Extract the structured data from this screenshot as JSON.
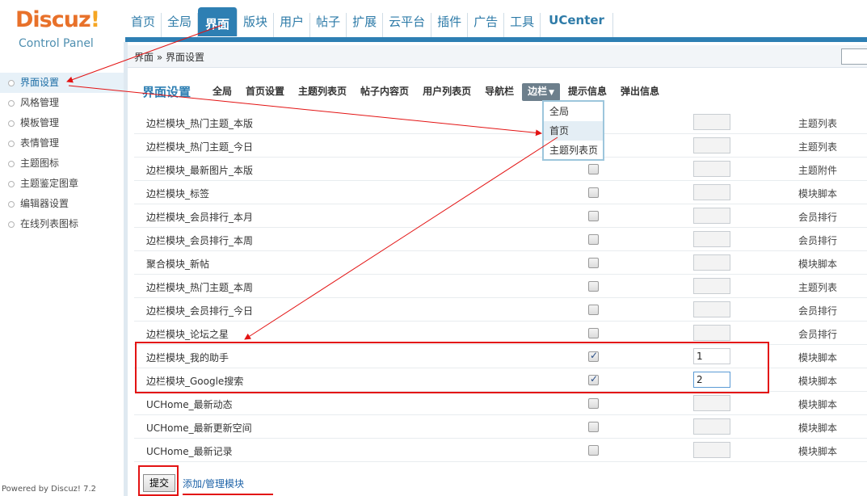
{
  "logo": {
    "brand": "Discuz",
    "bang": "!",
    "subtitle": "Control Panel"
  },
  "topnav": [
    {
      "label": "首页"
    },
    {
      "label": "全局"
    },
    {
      "label": "界面"
    },
    {
      "label": "版块"
    },
    {
      "label": "用户"
    },
    {
      "label": "帖子"
    },
    {
      "label": "扩展"
    },
    {
      "label": "云平台"
    },
    {
      "label": "插件"
    },
    {
      "label": "广告"
    },
    {
      "label": "工具"
    },
    {
      "label": "UCenter"
    }
  ],
  "breadcrumb": "界面 » 界面设置",
  "sidebar": {
    "items": [
      {
        "label": "界面设置"
      },
      {
        "label": "风格管理"
      },
      {
        "label": "模板管理"
      },
      {
        "label": "表情管理"
      },
      {
        "label": "主题图标"
      },
      {
        "label": "主题鉴定图章"
      },
      {
        "label": "编辑器设置"
      },
      {
        "label": "在线列表图标"
      }
    ],
    "powered": "Powered by Discuz! 7.2"
  },
  "page_title": "界面设置",
  "subnav": [
    {
      "label": "全局"
    },
    {
      "label": "首页设置"
    },
    {
      "label": "主题列表页"
    },
    {
      "label": "帖子内容页"
    },
    {
      "label": "用户列表页"
    },
    {
      "label": "导航栏"
    },
    {
      "label": "边栏",
      "caret": "▼"
    },
    {
      "label": "提示信息"
    },
    {
      "label": "弹出信息"
    }
  ],
  "dropdown": [
    {
      "label": "全局"
    },
    {
      "label": "首页"
    },
    {
      "label": "主题列表页"
    }
  ],
  "rows": [
    {
      "name": "边栏模块_热门主题_本版",
      "checked": false,
      "order": "",
      "type": "主题列表"
    },
    {
      "name": "边栏模块_热门主题_今日",
      "checked": false,
      "order": "",
      "type": "主题列表"
    },
    {
      "name": "边栏模块_最新图片_本版",
      "checked": false,
      "order": "",
      "type": "主题附件"
    },
    {
      "name": "边栏模块_标签",
      "checked": false,
      "order": "",
      "type": "模块脚本"
    },
    {
      "name": "边栏模块_会员排行_本月",
      "checked": false,
      "order": "",
      "type": "会员排行"
    },
    {
      "name": "边栏模块_会员排行_本周",
      "checked": false,
      "order": "",
      "type": "会员排行"
    },
    {
      "name": "聚合模块_新帖",
      "checked": false,
      "order": "",
      "type": "模块脚本"
    },
    {
      "name": "边栏模块_热门主题_本周",
      "checked": false,
      "order": "",
      "type": "主题列表"
    },
    {
      "name": "边栏模块_会员排行_今日",
      "checked": false,
      "order": "",
      "type": "会员排行"
    },
    {
      "name": "边栏模块_论坛之星",
      "checked": false,
      "order": "",
      "type": "会员排行"
    },
    {
      "name": "边栏模块_我的助手",
      "checked": true,
      "order": "1",
      "type": "模块脚本"
    },
    {
      "name": "边栏模块_Google搜索",
      "checked": true,
      "order": "2",
      "type": "模块脚本"
    },
    {
      "name": "UCHome_最新动态",
      "checked": false,
      "order": "",
      "type": "模块脚本"
    },
    {
      "name": "UCHome_最新更新空间",
      "checked": false,
      "order": "",
      "type": "模块脚本"
    },
    {
      "name": "UCHome_最新记录",
      "checked": false,
      "order": "",
      "type": "模块脚本"
    }
  ],
  "submit_label": "提交",
  "add_link": "添加/管理模块",
  "colors": {
    "accent": "#2e7fb3",
    "annotation": "#e31313",
    "brand": "#e8712a"
  }
}
